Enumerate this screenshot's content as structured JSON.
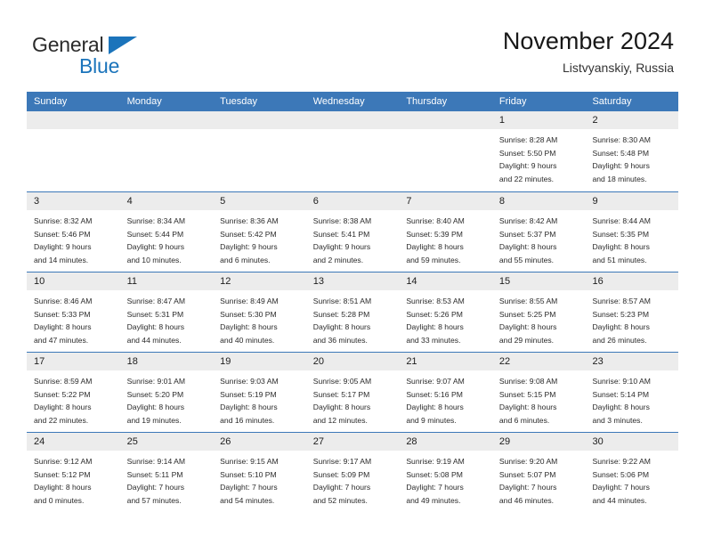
{
  "brand": {
    "name_top": "General",
    "name_bottom": "Blue",
    "triangle_color": "#1b74bb",
    "text_color": "#2b2b2b"
  },
  "header": {
    "title": "November 2024",
    "subtitle": "Listvyanskiy, Russia"
  },
  "theme": {
    "header_bg": "#3c78b8",
    "header_text": "#ffffff",
    "day_band_bg": "#ececec",
    "row_divider": "#3c78b8",
    "body_text": "#2a2a2a"
  },
  "weekdays": [
    "Sunday",
    "Monday",
    "Tuesday",
    "Wednesday",
    "Thursday",
    "Friday",
    "Saturday"
  ],
  "weeks": [
    [
      {
        "day": "",
        "lines": []
      },
      {
        "day": "",
        "lines": []
      },
      {
        "day": "",
        "lines": []
      },
      {
        "day": "",
        "lines": []
      },
      {
        "day": "",
        "lines": []
      },
      {
        "day": "1",
        "lines": [
          "Sunrise: 8:28 AM",
          "Sunset: 5:50 PM",
          "Daylight: 9 hours",
          "and 22 minutes."
        ]
      },
      {
        "day": "2",
        "lines": [
          "Sunrise: 8:30 AM",
          "Sunset: 5:48 PM",
          "Daylight: 9 hours",
          "and 18 minutes."
        ]
      }
    ],
    [
      {
        "day": "3",
        "lines": [
          "Sunrise: 8:32 AM",
          "Sunset: 5:46 PM",
          "Daylight: 9 hours",
          "and 14 minutes."
        ]
      },
      {
        "day": "4",
        "lines": [
          "Sunrise: 8:34 AM",
          "Sunset: 5:44 PM",
          "Daylight: 9 hours",
          "and 10 minutes."
        ]
      },
      {
        "day": "5",
        "lines": [
          "Sunrise: 8:36 AM",
          "Sunset: 5:42 PM",
          "Daylight: 9 hours",
          "and 6 minutes."
        ]
      },
      {
        "day": "6",
        "lines": [
          "Sunrise: 8:38 AM",
          "Sunset: 5:41 PM",
          "Daylight: 9 hours",
          "and 2 minutes."
        ]
      },
      {
        "day": "7",
        "lines": [
          "Sunrise: 8:40 AM",
          "Sunset: 5:39 PM",
          "Daylight: 8 hours",
          "and 59 minutes."
        ]
      },
      {
        "day": "8",
        "lines": [
          "Sunrise: 8:42 AM",
          "Sunset: 5:37 PM",
          "Daylight: 8 hours",
          "and 55 minutes."
        ]
      },
      {
        "day": "9",
        "lines": [
          "Sunrise: 8:44 AM",
          "Sunset: 5:35 PM",
          "Daylight: 8 hours",
          "and 51 minutes."
        ]
      }
    ],
    [
      {
        "day": "10",
        "lines": [
          "Sunrise: 8:46 AM",
          "Sunset: 5:33 PM",
          "Daylight: 8 hours",
          "and 47 minutes."
        ]
      },
      {
        "day": "11",
        "lines": [
          "Sunrise: 8:47 AM",
          "Sunset: 5:31 PM",
          "Daylight: 8 hours",
          "and 44 minutes."
        ]
      },
      {
        "day": "12",
        "lines": [
          "Sunrise: 8:49 AM",
          "Sunset: 5:30 PM",
          "Daylight: 8 hours",
          "and 40 minutes."
        ]
      },
      {
        "day": "13",
        "lines": [
          "Sunrise: 8:51 AM",
          "Sunset: 5:28 PM",
          "Daylight: 8 hours",
          "and 36 minutes."
        ]
      },
      {
        "day": "14",
        "lines": [
          "Sunrise: 8:53 AM",
          "Sunset: 5:26 PM",
          "Daylight: 8 hours",
          "and 33 minutes."
        ]
      },
      {
        "day": "15",
        "lines": [
          "Sunrise: 8:55 AM",
          "Sunset: 5:25 PM",
          "Daylight: 8 hours",
          "and 29 minutes."
        ]
      },
      {
        "day": "16",
        "lines": [
          "Sunrise: 8:57 AM",
          "Sunset: 5:23 PM",
          "Daylight: 8 hours",
          "and 26 minutes."
        ]
      }
    ],
    [
      {
        "day": "17",
        "lines": [
          "Sunrise: 8:59 AM",
          "Sunset: 5:22 PM",
          "Daylight: 8 hours",
          "and 22 minutes."
        ]
      },
      {
        "day": "18",
        "lines": [
          "Sunrise: 9:01 AM",
          "Sunset: 5:20 PM",
          "Daylight: 8 hours",
          "and 19 minutes."
        ]
      },
      {
        "day": "19",
        "lines": [
          "Sunrise: 9:03 AM",
          "Sunset: 5:19 PM",
          "Daylight: 8 hours",
          "and 16 minutes."
        ]
      },
      {
        "day": "20",
        "lines": [
          "Sunrise: 9:05 AM",
          "Sunset: 5:17 PM",
          "Daylight: 8 hours",
          "and 12 minutes."
        ]
      },
      {
        "day": "21",
        "lines": [
          "Sunrise: 9:07 AM",
          "Sunset: 5:16 PM",
          "Daylight: 8 hours",
          "and 9 minutes."
        ]
      },
      {
        "day": "22",
        "lines": [
          "Sunrise: 9:08 AM",
          "Sunset: 5:15 PM",
          "Daylight: 8 hours",
          "and 6 minutes."
        ]
      },
      {
        "day": "23",
        "lines": [
          "Sunrise: 9:10 AM",
          "Sunset: 5:14 PM",
          "Daylight: 8 hours",
          "and 3 minutes."
        ]
      }
    ],
    [
      {
        "day": "24",
        "lines": [
          "Sunrise: 9:12 AM",
          "Sunset: 5:12 PM",
          "Daylight: 8 hours",
          "and 0 minutes."
        ]
      },
      {
        "day": "25",
        "lines": [
          "Sunrise: 9:14 AM",
          "Sunset: 5:11 PM",
          "Daylight: 7 hours",
          "and 57 minutes."
        ]
      },
      {
        "day": "26",
        "lines": [
          "Sunrise: 9:15 AM",
          "Sunset: 5:10 PM",
          "Daylight: 7 hours",
          "and 54 minutes."
        ]
      },
      {
        "day": "27",
        "lines": [
          "Sunrise: 9:17 AM",
          "Sunset: 5:09 PM",
          "Daylight: 7 hours",
          "and 52 minutes."
        ]
      },
      {
        "day": "28",
        "lines": [
          "Sunrise: 9:19 AM",
          "Sunset: 5:08 PM",
          "Daylight: 7 hours",
          "and 49 minutes."
        ]
      },
      {
        "day": "29",
        "lines": [
          "Sunrise: 9:20 AM",
          "Sunset: 5:07 PM",
          "Daylight: 7 hours",
          "and 46 minutes."
        ]
      },
      {
        "day": "30",
        "lines": [
          "Sunrise: 9:22 AM",
          "Sunset: 5:06 PM",
          "Daylight: 7 hours",
          "and 44 minutes."
        ]
      }
    ]
  ]
}
